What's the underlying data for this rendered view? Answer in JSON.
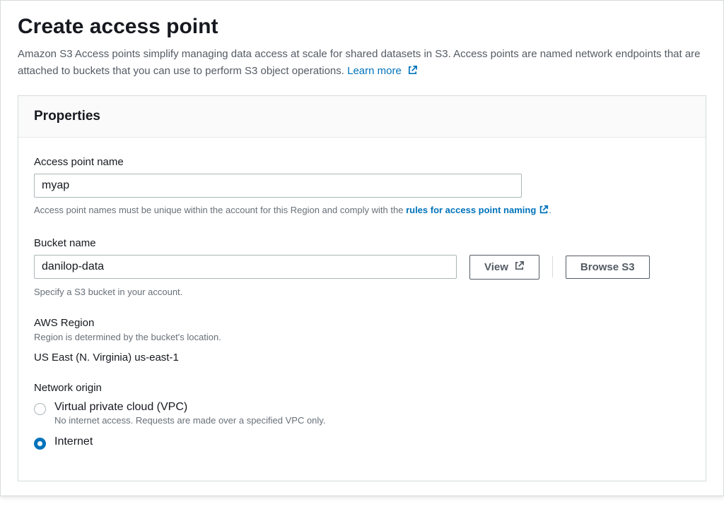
{
  "header": {
    "title": "Create access point",
    "desc": "Amazon S3 Access points simplify managing data access at scale for shared datasets in S3. Access points are named network endpoints that are attached to buckets that you can use to perform S3 object operations. ",
    "learn_more": "Learn more"
  },
  "panel": {
    "title": "Properties"
  },
  "access_point": {
    "label": "Access point name",
    "value": "myap",
    "hint_prefix": "Access point names must be unique within the account for this Region and comply with the ",
    "hint_link": "rules for access point naming",
    "hint_suffix": "."
  },
  "bucket": {
    "label": "Bucket name",
    "value": "danilop-data",
    "hint": "Specify a S3 bucket in your account.",
    "view_btn": "View",
    "browse_btn": "Browse S3"
  },
  "region": {
    "label": "AWS Region",
    "hint": "Region is determined by the bucket's location.",
    "value": "US East (N. Virginia) us-east-1"
  },
  "network_origin": {
    "label": "Network origin",
    "options": [
      {
        "label": "Virtual private cloud (VPC)",
        "desc": "No internet access. Requests are made over a specified VPC only.",
        "selected": false
      },
      {
        "label": "Internet",
        "desc": "",
        "selected": true
      }
    ]
  }
}
